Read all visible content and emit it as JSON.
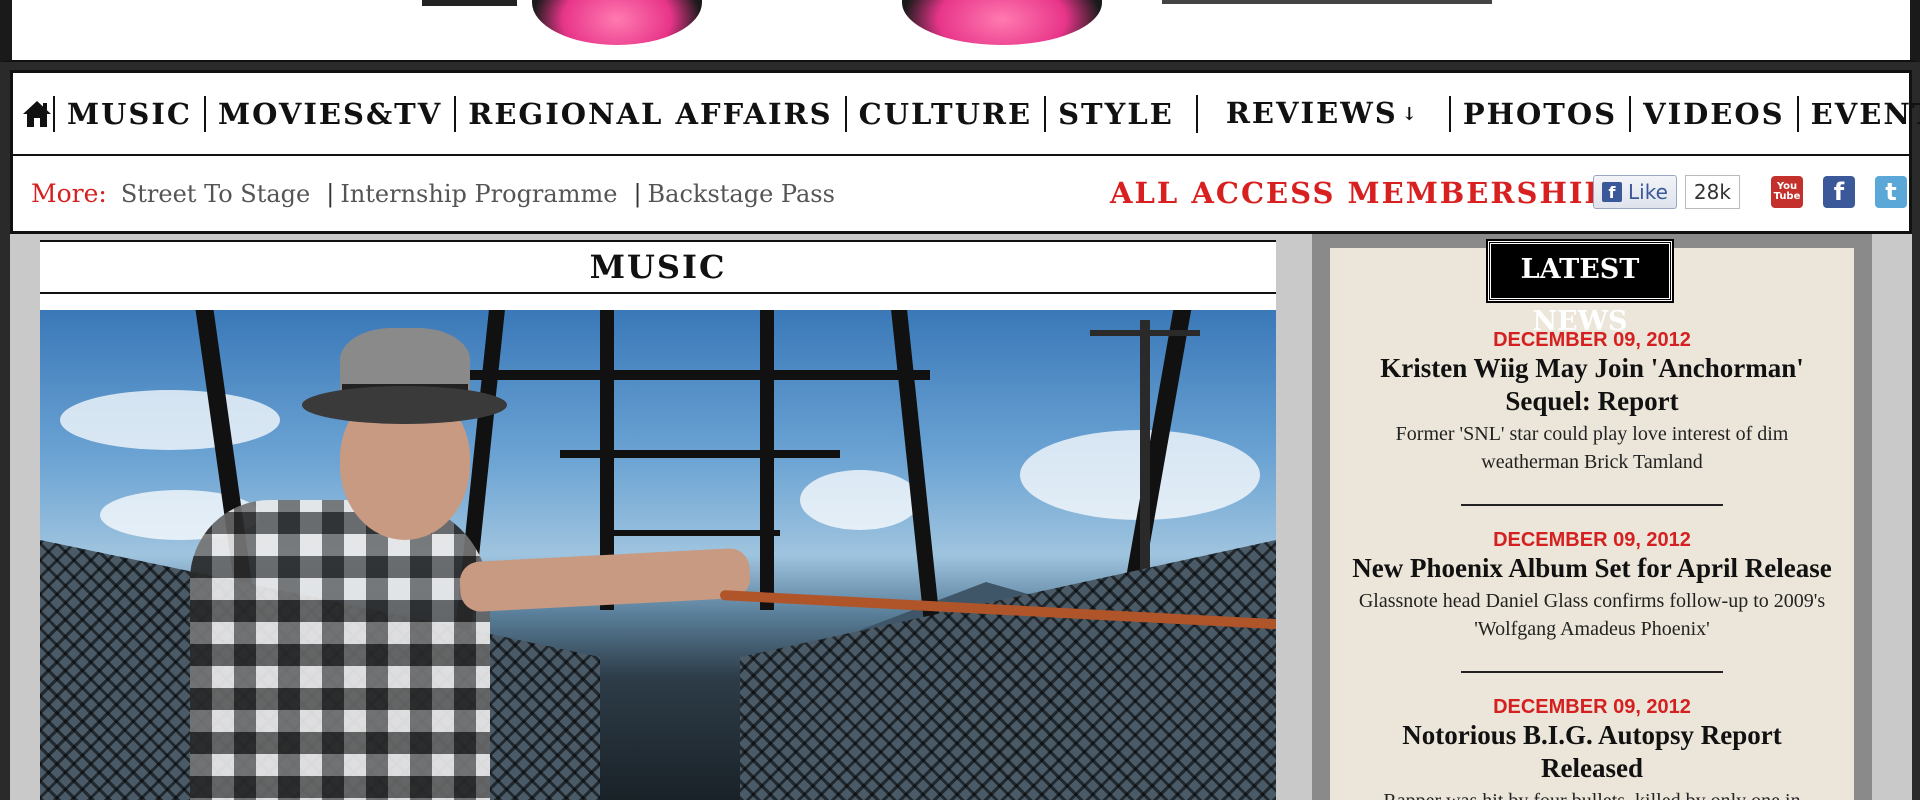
{
  "nav": {
    "items": [
      {
        "label": "MUSIC"
      },
      {
        "label": "MOVIES&TV"
      },
      {
        "label": "REGIONAL AFFAIRS"
      },
      {
        "label": "CULTURE"
      },
      {
        "label": "STYLE"
      },
      {
        "label": "REVIEWS",
        "has_dropdown": true
      },
      {
        "label": "PHOTOS"
      },
      {
        "label": "VIDEOS"
      },
      {
        "label": "EVENTS"
      }
    ],
    "home_icon": "home-icon",
    "dropdown_icon": "chevron-down-icon"
  },
  "subnav": {
    "more_label": "More:",
    "links": [
      "Street To Stage",
      "Internship Programme",
      "Backstage Pass"
    ],
    "membership": "ALL ACCESS MEMBERSHIP",
    "fb_like_label": "Like",
    "fb_like_count": "28k",
    "social": [
      "youtube-icon",
      "facebook-icon",
      "twitter-icon"
    ]
  },
  "section": {
    "title": "MUSIC"
  },
  "sidebar": {
    "header": "LATEST NEWS",
    "news": [
      {
        "date": "DECEMBER 09, 2012",
        "title": "Kristen Wiig May Join 'Anchorman' Sequel: Report",
        "desc": "Former 'SNL' star could play love interest of dim weatherman Brick Tamland"
      },
      {
        "date": "DECEMBER 09, 2012",
        "title": "New Phoenix Album Set for April Release",
        "desc": "Glassnote head Daniel Glass confirms follow-up to 2009's 'Wolfgang Amadeus Phoenix'"
      },
      {
        "date": "DECEMBER 09, 2012",
        "title": "Notorious B.I.G. Autopsy Report Released",
        "desc": "Rapper was hit by four bullets, killed by only one in"
      }
    ]
  },
  "colors": {
    "accent_red": "#d42020",
    "facebook_blue": "#3b5998",
    "logo_pink": "#e8358a"
  }
}
